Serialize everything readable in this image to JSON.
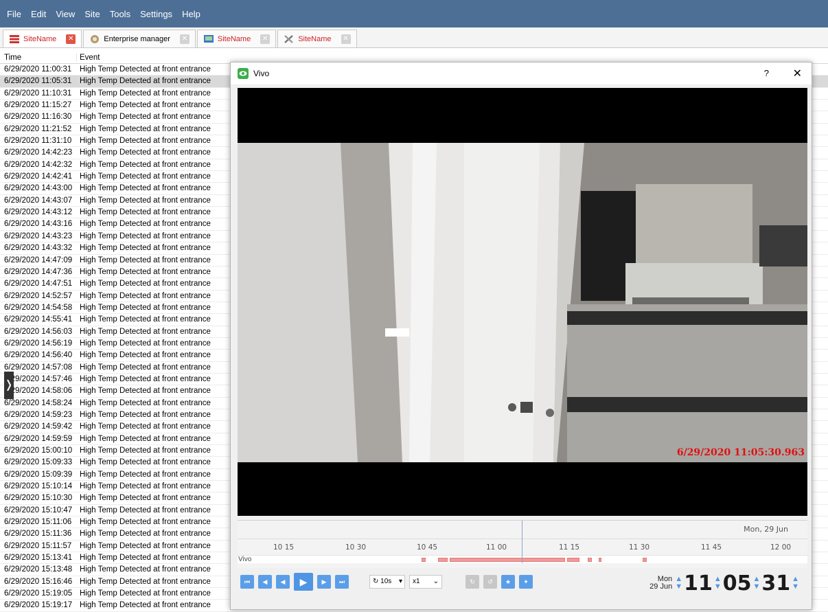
{
  "menubar": {
    "items": [
      "File",
      "Edit",
      "View",
      "Site",
      "Tools",
      "Settings",
      "Help"
    ]
  },
  "tabs": [
    {
      "label": "SiteName",
      "icon": "server-icon",
      "active": true
    },
    {
      "label": "Enterprise manager",
      "icon": "enterprise-icon",
      "active": false
    },
    {
      "label": "SiteName",
      "icon": "monitor-icon",
      "active": false
    },
    {
      "label": "SiteName",
      "icon": "tools-icon",
      "active": false
    }
  ],
  "events": {
    "columns": [
      "Time",
      "Event"
    ],
    "selected_index": 1,
    "rows": [
      [
        "6/29/2020 11:00:31",
        "High Temp Detected at front entrance"
      ],
      [
        "6/29/2020 11:05:31",
        "High Temp Detected at front entrance"
      ],
      [
        "6/29/2020 11:10:31",
        "High Temp Detected at front entrance"
      ],
      [
        "6/29/2020 11:15:27",
        "High Temp Detected at front entrance"
      ],
      [
        "6/29/2020 11:16:30",
        "High Temp Detected at front entrance"
      ],
      [
        "6/29/2020 11:21:52",
        "High Temp Detected at front entrance"
      ],
      [
        "6/29/2020 11:31:10",
        "High Temp Detected at front entrance"
      ],
      [
        "6/29/2020 14:42:23",
        "High Temp Detected at front entrance"
      ],
      [
        "6/29/2020 14:42:32",
        "High Temp Detected at front entrance"
      ],
      [
        "6/29/2020 14:42:41",
        "High Temp Detected at front entrance"
      ],
      [
        "6/29/2020 14:43:00",
        "High Temp Detected at front entrance"
      ],
      [
        "6/29/2020 14:43:07",
        "High Temp Detected at front entrance"
      ],
      [
        "6/29/2020 14:43:12",
        "High Temp Detected at front entrance"
      ],
      [
        "6/29/2020 14:43:16",
        "High Temp Detected at front entrance"
      ],
      [
        "6/29/2020 14:43:23",
        "High Temp Detected at front entrance"
      ],
      [
        "6/29/2020 14:43:32",
        "High Temp Detected at front entrance"
      ],
      [
        "6/29/2020 14:47:09",
        "High Temp Detected at front entrance"
      ],
      [
        "6/29/2020 14:47:36",
        "High Temp Detected at front entrance"
      ],
      [
        "6/29/2020 14:47:51",
        "High Temp Detected at front entrance"
      ],
      [
        "6/29/2020 14:52:57",
        "High Temp Detected at front entrance"
      ],
      [
        "6/29/2020 14:54:58",
        "High Temp Detected at front entrance"
      ],
      [
        "6/29/2020 14:55:41",
        "High Temp Detected at front entrance"
      ],
      [
        "6/29/2020 14:56:03",
        "High Temp Detected at front entrance"
      ],
      [
        "6/29/2020 14:56:19",
        "High Temp Detected at front entrance"
      ],
      [
        "6/29/2020 14:56:40",
        "High Temp Detected at front entrance"
      ],
      [
        "6/29/2020 14:57:08",
        "High Temp Detected at front entrance"
      ],
      [
        "6/29/2020 14:57:46",
        "High Temp Detected at front entrance"
      ],
      [
        "6/29/2020 14:58:06",
        "High Temp Detected at front entrance"
      ],
      [
        "6/29/2020 14:58:24",
        "High Temp Detected at front entrance"
      ],
      [
        "6/29/2020 14:59:23",
        "High Temp Detected at front entrance"
      ],
      [
        "6/29/2020 14:59:42",
        "High Temp Detected at front entrance"
      ],
      [
        "6/29/2020 14:59:59",
        "High Temp Detected at front entrance"
      ],
      [
        "6/29/2020 15:00:10",
        "High Temp Detected at front entrance"
      ],
      [
        "6/29/2020 15:09:33",
        "High Temp Detected at front entrance"
      ],
      [
        "6/29/2020 15:09:39",
        "High Temp Detected at front entrance"
      ],
      [
        "6/29/2020 15:10:14",
        "High Temp Detected at front entrance"
      ],
      [
        "6/29/2020 15:10:30",
        "High Temp Detected at front entrance"
      ],
      [
        "6/29/2020 15:10:47",
        "High Temp Detected at front entrance"
      ],
      [
        "6/29/2020 15:11:06",
        "High Temp Detected at front entrance"
      ],
      [
        "6/29/2020 15:11:36",
        "High Temp Detected at front entrance"
      ],
      [
        "6/29/2020 15:11:57",
        "High Temp Detected at front entrance"
      ],
      [
        "6/29/2020 15:13:41",
        "High Temp Detected at front entrance"
      ],
      [
        "6/29/2020 15:13:48",
        "High Temp Detected at front entrance"
      ],
      [
        "6/29/2020 15:16:46",
        "High Temp Detected at front entrance"
      ],
      [
        "6/29/2020 15:19:05",
        "High Temp Detected at front entrance"
      ],
      [
        "6/29/2020 15:19:17",
        "High Temp Detected at front entrance"
      ]
    ]
  },
  "vivo": {
    "title": "Vivo",
    "help": "?",
    "close": "✕",
    "timestamp": "6/29/2020 11:05:30.963",
    "timeline": {
      "date_label": "Mon, 29 Jun",
      "ticks": [
        "10 15",
        "10 30",
        "10 45",
        "11 00",
        "11 15",
        "11 30",
        "11 45",
        "12 00"
      ],
      "row_label": "Vivo"
    },
    "controls": {
      "loop_label": "10s",
      "speed_label": "x1"
    },
    "clock": {
      "day": "Mon",
      "date": "29 Jun",
      "hh": "11",
      "mm": "05",
      "ss": "31"
    }
  },
  "colors": {
    "menubar": "#4d6f96",
    "accent": "#4f95e3",
    "recording": "#f19a9a",
    "timestamp": "#e01010"
  }
}
